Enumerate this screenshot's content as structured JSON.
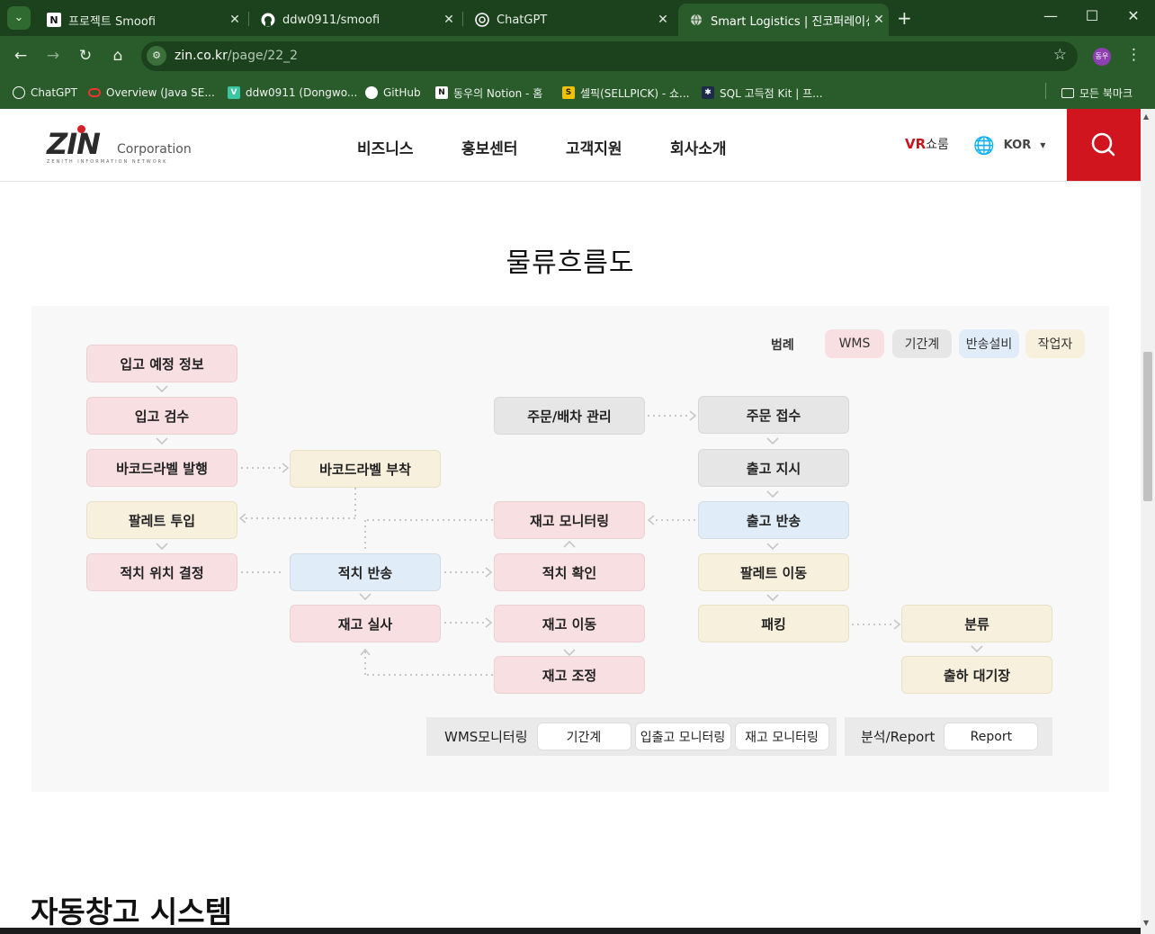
{
  "browser": {
    "tabs": [
      {
        "title": "프로젝트 Smoofi",
        "icon": "notion-icon"
      },
      {
        "title": "ddw0911/smoofi",
        "icon": "github-icon"
      },
      {
        "title": "ChatGPT",
        "icon": "chatgpt-icon"
      },
      {
        "title": "Smart Logistics | 진코퍼레이션",
        "icon": "globe-icon",
        "active": true
      }
    ],
    "url_host": "zin.co.kr",
    "url_path": "/page/22_2",
    "profile": "동우",
    "bookmarks": [
      "ChatGPT",
      "Overview (Java SE...",
      "ddw0911 (Dongwo...",
      "GitHub",
      "동우의 Notion - 홈",
      "셀픽(SELLPICK) - 쇼...",
      "SQL 고득점 Kit | 프..."
    ],
    "all_bookmarks": "모든 북마크"
  },
  "site": {
    "logo": "ZIN",
    "logo_corp": "Corporation",
    "logo_sub": "ZENITH INFORMATION NETWORK",
    "nav": [
      "비즈니스",
      "홍보센터",
      "고객지원",
      "회사소개"
    ],
    "vr": "VR",
    "vr_label": "쇼룸",
    "lang": "KOR"
  },
  "main": {
    "title": "물류흐름도",
    "section2_title": "자동창고 시스템"
  },
  "legend": {
    "title": "범례",
    "items": [
      {
        "label": "WMS",
        "color": "#f8dfe1"
      },
      {
        "label": "기간계",
        "color": "#e6e6e6"
      },
      {
        "label": "반송설비",
        "color": "#e0ecf7"
      },
      {
        "label": "작업자",
        "color": "#f7f0dd"
      }
    ]
  },
  "flow": {
    "nodes": [
      "입고 예정 정보",
      "입고 검수",
      "바코드라벨 발행",
      "팔레트 투입",
      "적치 위치 결정",
      "바코드라벨 부착",
      "적치 반송",
      "재고 실사",
      "주문/배차 관리",
      "재고 모니터링",
      "적치 확인",
      "재고 이동",
      "재고 조정",
      "주문 접수",
      "출고 지시",
      "출고 반송",
      "팔레트 이동",
      "패킹",
      "분류",
      "출하 대기장"
    ]
  },
  "monitoring": {
    "label": "WMS모니터링",
    "buttons": [
      "기간계",
      "입출고 모니터링",
      "재고 모니터링"
    ],
    "report_label": "분석/Report",
    "report_button": "Report"
  }
}
